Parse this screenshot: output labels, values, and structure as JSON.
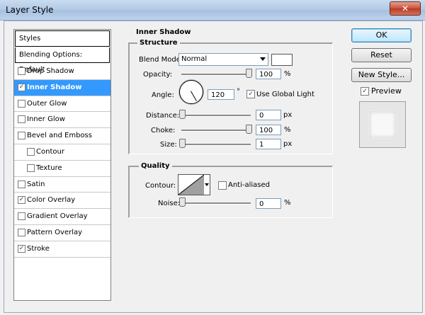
{
  "window": {
    "title": "Layer Style",
    "close_label": "✕"
  },
  "styles_panel": {
    "header": "Styles",
    "blending_options": "Blending Options: Default",
    "items": [
      {
        "label": "Drop Shadow",
        "checked": false,
        "sub": false,
        "selected": false
      },
      {
        "label": "Inner Shadow",
        "checked": true,
        "sub": false,
        "selected": true
      },
      {
        "label": "Outer Glow",
        "checked": false,
        "sub": false,
        "selected": false
      },
      {
        "label": "Inner Glow",
        "checked": false,
        "sub": false,
        "selected": false
      },
      {
        "label": "Bevel and Emboss",
        "checked": false,
        "sub": false,
        "selected": false
      },
      {
        "label": "Contour",
        "checked": false,
        "sub": true,
        "selected": false
      },
      {
        "label": "Texture",
        "checked": false,
        "sub": true,
        "selected": false
      },
      {
        "label": "Satin",
        "checked": false,
        "sub": false,
        "selected": false
      },
      {
        "label": "Color Overlay",
        "checked": true,
        "sub": false,
        "selected": false
      },
      {
        "label": "Gradient Overlay",
        "checked": false,
        "sub": false,
        "selected": false
      },
      {
        "label": "Pattern Overlay",
        "checked": false,
        "sub": false,
        "selected": false
      },
      {
        "label": "Stroke",
        "checked": true,
        "sub": false,
        "selected": false
      }
    ]
  },
  "inner_shadow": {
    "section_title": "Inner Shadow",
    "structure": {
      "title": "Structure",
      "blend_mode_label": "Blend Mode:",
      "blend_mode_value": "Normal",
      "opacity_label": "Opacity:",
      "opacity_value": "100",
      "opacity_unit": "%",
      "angle_label": "Angle:",
      "angle_value": "120",
      "angle_unit": "°",
      "use_global_light_label": "Use Global Light",
      "use_global_light_checked": true,
      "distance_label": "Distance:",
      "distance_value": "0",
      "distance_unit": "px",
      "choke_label": "Choke:",
      "choke_value": "100",
      "choke_unit": "%",
      "size_label": "Size:",
      "size_value": "1",
      "size_unit": "px"
    },
    "quality": {
      "title": "Quality",
      "contour_label": "Contour:",
      "anti_aliased_label": "Anti-aliased",
      "anti_aliased_checked": false,
      "noise_label": "Noise:",
      "noise_value": "0",
      "noise_unit": "%"
    }
  },
  "buttons": {
    "ok": "OK",
    "reset": "Reset",
    "new_style": "New Style...",
    "preview_label": "Preview",
    "preview_checked": true
  },
  "colors": {
    "selection": "#3399ff",
    "swatch": "#ffffff"
  }
}
